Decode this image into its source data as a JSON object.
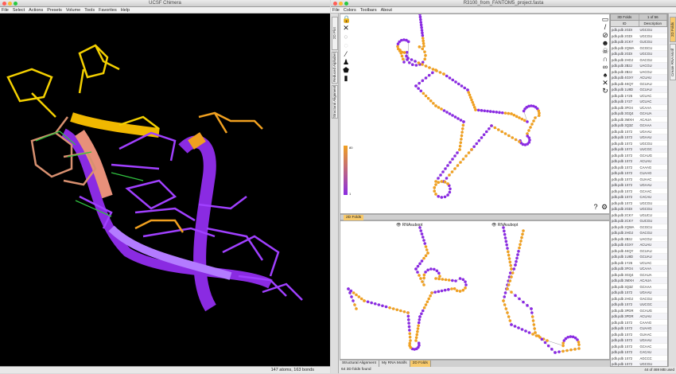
{
  "chimera": {
    "title": "UCSF Chimera",
    "menu": [
      "File",
      "Select",
      "Actions",
      "Presets",
      "Volume",
      "Tools",
      "Favorites",
      "Help"
    ],
    "status": "147 atoms, 163 bonds"
  },
  "assemble": {
    "title": "R3100_from_FANTOM5_project.fasta",
    "menu": [
      "File",
      "Colors",
      "Toolbars",
      "About"
    ],
    "left_tabs": [
      "2D Plot",
      "Reduced Alphabet",
      "Structural Alignment"
    ],
    "right_tabs": [
      "2D Folds",
      "Create RNA Motif"
    ],
    "legend_min": "1",
    "legend_max": "80",
    "lower_tabbar_label": "2D Folds",
    "lower_panels": [
      {
        "label": "RNAsubopt"
      },
      {
        "label": "RNAsubopt"
      }
    ],
    "bottom_tabs": [
      "Structural Alignment",
      "My RNA Motifs",
      "2D Folds"
    ],
    "status_left": "64 3D folds found",
    "memory": "44 of 469 MB used",
    "table_title": "3D Folds",
    "table_count": "1 of 56",
    "table_headers": [
      "ID",
      "Description"
    ],
    "table_rows": [
      [
        "pdb.pdb 2GDI",
        "UGCGU"
      ],
      [
        "pdb.pdb 2GDI",
        "UGCGU"
      ],
      [
        "pdb.pdb 2CKY",
        "GUCGU"
      ],
      [
        "pdb.pdb 2QWA",
        "GCGCU"
      ],
      [
        "pdb.pdb 2GDI",
        "UGCGU"
      ],
      [
        "pdb.pdb 2HOJ",
        "GACGU"
      ],
      [
        "pdb.pdb 2B3J",
        "UACGU"
      ],
      [
        "pdb.pdb 2B3J",
        "UACGU"
      ],
      [
        "pdb.pdb 4GXY",
        "ACUAU"
      ],
      [
        "pdb.pdb 4KQY",
        "GCUAU"
      ],
      [
        "pdb.pdb 1U8D",
        "GCUAU"
      ],
      [
        "pdb.pdb 1Y26",
        "UCUAC"
      ],
      [
        "pdb.pdb 1Y27",
        "UCUAC"
      ],
      [
        "pdb.pdb 3FO4",
        "UCAAA"
      ],
      [
        "pdb.pdb 3GQ4",
        "GCAUA"
      ],
      [
        "pdb.pdb 3MXH",
        "ACAUA"
      ],
      [
        "pdb.pdb 3Q3Z",
        "GCAAA"
      ],
      [
        "pdb.pdb 1S72",
        "UGAAU"
      ],
      [
        "pdb.pdb 1S72",
        "UGAAU"
      ],
      [
        "pdb.pdb 1S72",
        "UGCGU"
      ],
      [
        "pdb.pdb 1S72",
        "UUCGC"
      ],
      [
        "pdb.pdb 1S72",
        "GCAUG"
      ],
      [
        "pdb.pdb 1S72",
        "ACUAU"
      ],
      [
        "pdb.pdb 1S72",
        "CAAAG"
      ],
      [
        "pdb.pdb 1S72",
        "CUAAG"
      ],
      [
        "pdb.pdb 1S72",
        "GUAAC"
      ],
      [
        "pdb.pdb 1S72",
        "UGAAU"
      ],
      [
        "pdb.pdb 1S72",
        "GCAAC"
      ],
      [
        "pdb.pdb 1S72",
        "CACAU"
      ],
      [
        "pdb.pdb 1S72",
        "UGCGU"
      ],
      [
        "pdb.pdb 2GDI",
        "UGCGU"
      ],
      [
        "pdb.pdb 2CKY",
        "UGUCU"
      ],
      [
        "pdb.pdb 2CKY",
        "GUCGU"
      ],
      [
        "pdb.pdb 2QWA",
        "GCGCU"
      ],
      [
        "pdb.pdb 2HOJ",
        "GACGU"
      ],
      [
        "pdb.pdb 2B3J",
        "UACGU"
      ],
      [
        "pdb.pdb 4GXY",
        "ACUAU"
      ],
      [
        "pdb.pdb 4KQY",
        "GCUAU"
      ],
      [
        "pdb.pdb 1U8D",
        "GCUAU"
      ],
      [
        "pdb.pdb 1Y26",
        "UCUAC"
      ],
      [
        "pdb.pdb 3FO4",
        "UCAAA"
      ],
      [
        "pdb.pdb 3GQ4",
        "GCAUA"
      ],
      [
        "pdb.pdb 3MXH",
        "ACAUA"
      ],
      [
        "pdb.pdb 3Q3Z",
        "GCAAA"
      ],
      [
        "pdb.pdb 1S72",
        "UGAAU"
      ],
      [
        "pdb.pdb 2HOJ",
        "GACGU"
      ],
      [
        "pdb.pdb 1S72",
        "UUCGC"
      ],
      [
        "pdb.pdb 3PDR",
        "GCAUG"
      ],
      [
        "pdb.pdb 3PDR",
        "ACUAU"
      ],
      [
        "pdb.pdb 1S72",
        "CAAAG"
      ],
      [
        "pdb.pdb 1S72",
        "CUAAG"
      ],
      [
        "pdb.pdb 1S72",
        "GUAAC"
      ],
      [
        "pdb.pdb 1S72",
        "UGAAU"
      ],
      [
        "pdb.pdb 1S72",
        "GCAAC"
      ],
      [
        "pdb.pdb 1S72",
        "CACAU"
      ],
      [
        "pdb.pdb 1S72",
        "AGCCC"
      ],
      [
        "pdb.pdb 1S72",
        "UGCGU"
      ],
      [
        "pdb.pdb 1S72",
        "CUCAU"
      ],
      [
        "pdb.pdb 1S72",
        "GACGU"
      ]
    ]
  },
  "colors": {
    "purple": "#8a2be2",
    "orange": "#f0a020",
    "yellow": "#e6d800",
    "salmon": "#e8907a"
  }
}
